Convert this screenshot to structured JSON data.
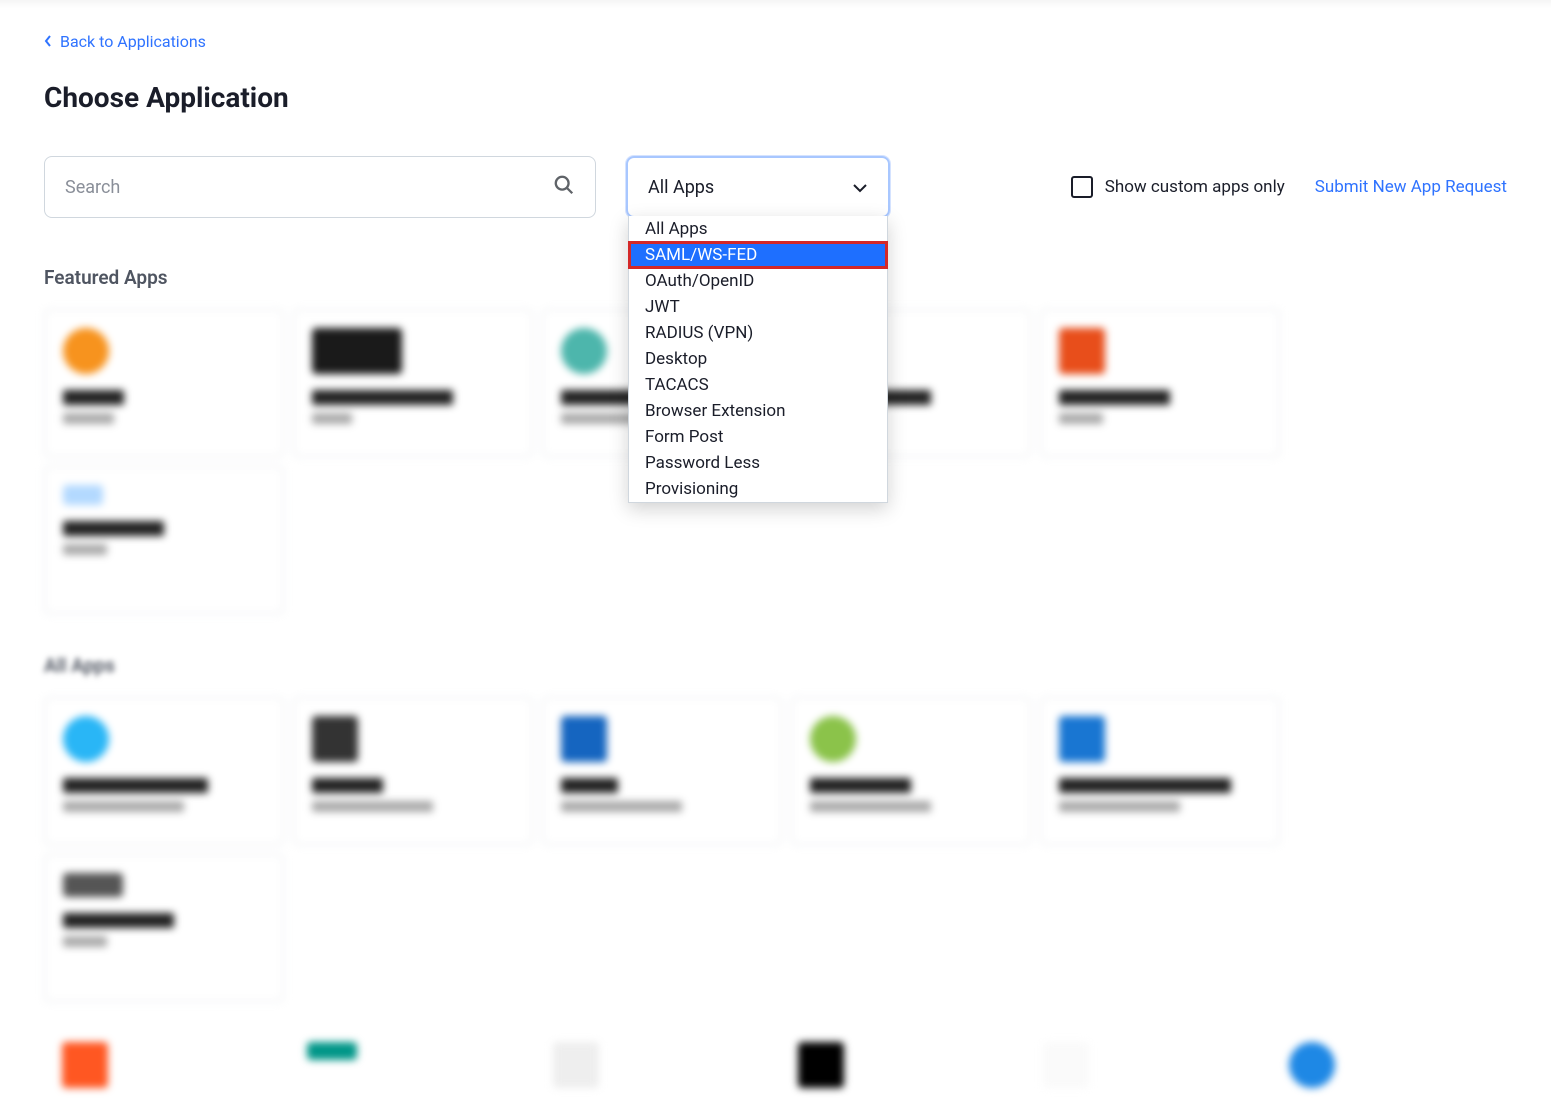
{
  "back_link": "Back to Applications",
  "page_title": "Choose Application",
  "search": {
    "placeholder": "Search"
  },
  "filter": {
    "selected": "All Apps",
    "options": [
      "All Apps",
      "SAML/WS-FED",
      "OAuth/OpenID",
      "JWT",
      "RADIUS (VPN)",
      "Desktop",
      "TACACS",
      "Browser Extension",
      "Form Post",
      "Password Less",
      "Provisioning"
    ],
    "highlighted_index": 1
  },
  "checkbox": {
    "label": "Show custom apps only"
  },
  "submit_link": "Submit New App Request",
  "sections": {
    "featured_title": "Featured Apps",
    "all_title": "All Apps"
  }
}
